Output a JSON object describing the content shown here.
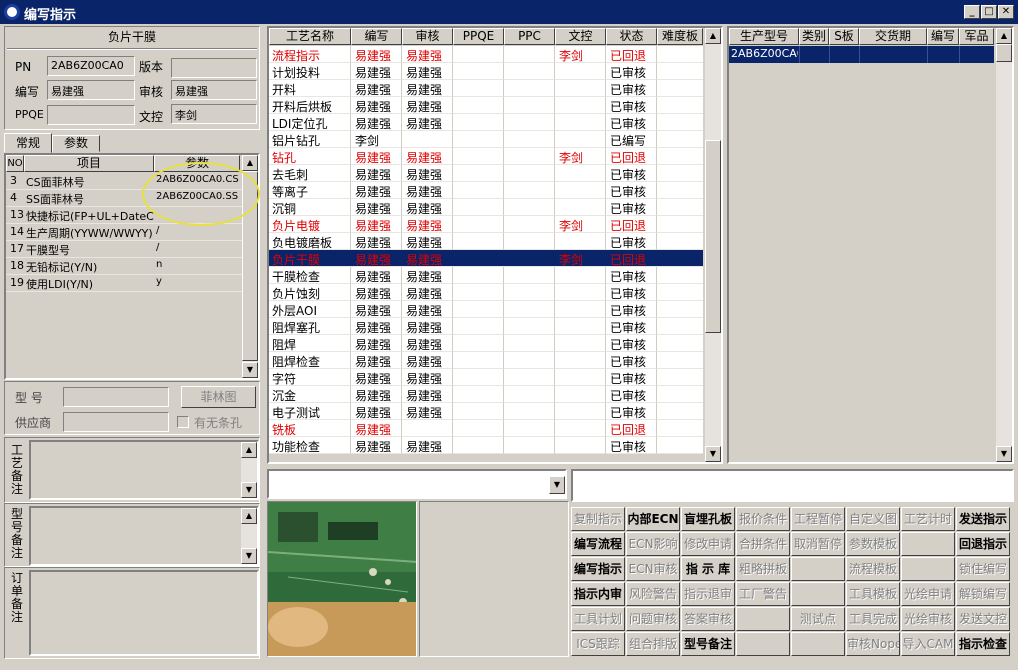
{
  "window": {
    "title": "编写指示"
  },
  "left": {
    "header": "负片干膜",
    "fields": {
      "pn_label": "PN",
      "pn_value": "2AB6Z00CA0",
      "version_label": "版本",
      "version_value": "",
      "author_label": "编写",
      "author_value": "易建强",
      "review_label": "审核",
      "review_value": "易建强",
      "ppqe_label": "PPQE",
      "ppqe_value": "",
      "doc_label": "文控",
      "doc_value": "李剑"
    },
    "tabs": [
      "常规",
      "参数"
    ],
    "param_table": {
      "headers": [
        "NO",
        "项目",
        "参数"
      ],
      "rows": [
        {
          "no": "3",
          "item": "CS面菲林号",
          "value": "2AB6Z00CA0.CS"
        },
        {
          "no": "4",
          "item": "SS面菲林号",
          "value": "2AB6Z00CA0.SS"
        },
        {
          "no": "13",
          "item": "快捷标记(FP+UL+DateC)",
          "value": ""
        },
        {
          "no": "14",
          "item": "生产周期(YYWW/WWYY)",
          "value": "/"
        },
        {
          "no": "17",
          "item": "干膜型号",
          "value": "/"
        },
        {
          "no": "18",
          "item": "无铅标记(Y/N)",
          "value": "n"
        },
        {
          "no": "19",
          "item": "使用LDI(Y/N)",
          "value": "y"
        }
      ]
    },
    "model_label": "型 号",
    "supplier_label": "供应商",
    "film_button": "菲林图",
    "slot_checkbox": "有无条孔",
    "remarks": [
      {
        "label": "工艺备注"
      },
      {
        "label": "型号备注"
      },
      {
        "label": "订单备注"
      }
    ]
  },
  "process_table": {
    "headers": [
      "工艺名称",
      "编写",
      "审核",
      "PPQE",
      "PPC",
      "文控",
      "状态",
      "难度板"
    ],
    "rows": [
      {
        "name": "流程指示",
        "author": "易建强",
        "review": "易建强",
        "ppqe": "",
        "ppc": "",
        "doc": "李剑",
        "status": "已回退",
        "red": true
      },
      {
        "name": "计划投料",
        "author": "易建强",
        "review": "易建强",
        "ppqe": "",
        "ppc": "",
        "doc": "",
        "status": "已审核",
        "red": false
      },
      {
        "name": "开料",
        "author": "易建强",
        "review": "易建强",
        "ppqe": "",
        "ppc": "",
        "doc": "",
        "status": "已审核",
        "red": false
      },
      {
        "name": "开料后烘板",
        "author": "易建强",
        "review": "易建强",
        "ppqe": "",
        "ppc": "",
        "doc": "",
        "status": "已审核",
        "red": false
      },
      {
        "name": "LDI定位孔",
        "author": "易建强",
        "review": "易建强",
        "ppqe": "",
        "ppc": "",
        "doc": "",
        "status": "已审核",
        "red": false
      },
      {
        "name": "铝片钻孔",
        "author": "李剑",
        "review": "",
        "ppqe": "",
        "ppc": "",
        "doc": "",
        "status": "已编写",
        "red": false
      },
      {
        "name": "钻孔",
        "author": "易建强",
        "review": "易建强",
        "ppqe": "",
        "ppc": "",
        "doc": "李剑",
        "status": "已回退",
        "red": true
      },
      {
        "name": "去毛刺",
        "author": "易建强",
        "review": "易建强",
        "ppqe": "",
        "ppc": "",
        "doc": "",
        "status": "已审核",
        "red": false
      },
      {
        "name": "等离子",
        "author": "易建强",
        "review": "易建强",
        "ppqe": "",
        "ppc": "",
        "doc": "",
        "status": "已审核",
        "red": false
      },
      {
        "name": "沉铜",
        "author": "易建强",
        "review": "易建强",
        "ppqe": "",
        "ppc": "",
        "doc": "",
        "status": "已审核",
        "red": false
      },
      {
        "name": "负片电镀",
        "author": "易建强",
        "review": "易建强",
        "ppqe": "",
        "ppc": "",
        "doc": "李剑",
        "status": "已回退",
        "red": true
      },
      {
        "name": "负电镀磨板",
        "author": "易建强",
        "review": "易建强",
        "ppqe": "",
        "ppc": "",
        "doc": "",
        "status": "已审核",
        "red": false
      },
      {
        "name": "负片干膜",
        "author": "易建强",
        "review": "易建强",
        "ppqe": "",
        "ppc": "",
        "doc": "李剑",
        "status": "已回退",
        "red": true,
        "selected": true
      },
      {
        "name": "干膜检查",
        "author": "易建强",
        "review": "易建强",
        "ppqe": "",
        "ppc": "",
        "doc": "",
        "status": "已审核",
        "red": false
      },
      {
        "name": "负片蚀刻",
        "author": "易建强",
        "review": "易建强",
        "ppqe": "",
        "ppc": "",
        "doc": "",
        "status": "已审核",
        "red": false
      },
      {
        "name": "外层AOI",
        "author": "易建强",
        "review": "易建强",
        "ppqe": "",
        "ppc": "",
        "doc": "",
        "status": "已审核",
        "red": false
      },
      {
        "name": "阻焊塞孔",
        "author": "易建强",
        "review": "易建强",
        "ppqe": "",
        "ppc": "",
        "doc": "",
        "status": "已审核",
        "red": false
      },
      {
        "name": "阻焊",
        "author": "易建强",
        "review": "易建强",
        "ppqe": "",
        "ppc": "",
        "doc": "",
        "status": "已审核",
        "red": false
      },
      {
        "name": "阻焊检查",
        "author": "易建强",
        "review": "易建强",
        "ppqe": "",
        "ppc": "",
        "doc": "",
        "status": "已审核",
        "red": false
      },
      {
        "name": "字符",
        "author": "易建强",
        "review": "易建强",
        "ppqe": "",
        "ppc": "",
        "doc": "",
        "status": "已审核",
        "red": false
      },
      {
        "name": "沉金",
        "author": "易建强",
        "review": "易建强",
        "ppqe": "",
        "ppc": "",
        "doc": "",
        "status": "已审核",
        "red": false
      },
      {
        "name": "电子测试",
        "author": "易建强",
        "review": "易建强",
        "ppqe": "",
        "ppc": "",
        "doc": "",
        "status": "已审核",
        "red": false
      },
      {
        "name": "铣板",
        "author": "易建强",
        "review": "",
        "ppqe": "",
        "ppc": "",
        "doc": "",
        "status": "已回退",
        "red": true
      },
      {
        "name": "功能检查",
        "author": "易建强",
        "review": "易建强",
        "ppqe": "",
        "ppc": "",
        "doc": "",
        "status": "已审核",
        "red": false
      }
    ]
  },
  "product_table": {
    "headers": [
      "生产型号",
      "类别",
      "S板",
      "交货期",
      "编写",
      "军品"
    ],
    "rows": [
      {
        "model": "2AB6Z00CA0",
        "type": "",
        "s": "",
        "due": "",
        "author": "",
        "mil": ""
      }
    ]
  },
  "buttons": [
    [
      "复制指示",
      "内部ECN",
      "盲埋孔板",
      "报价条件",
      "工程暂停",
      "自定义图",
      "工艺计时",
      "发送指示"
    ],
    [
      "编写流程",
      "ECN影响",
      "修改申请",
      "合拼条件",
      "取消暂停",
      "参数模板",
      "",
      "回退指示"
    ],
    [
      "编写指示",
      "ECN审核",
      "指 示 库",
      "粗略拼板",
      "",
      "流程模板",
      "",
      "锁住编写"
    ],
    [
      "指示内审",
      "风险警告",
      "指示退审",
      "工厂警告",
      "",
      "工具模板",
      "光绘申请",
      "解锁编写"
    ],
    [
      "工具计划",
      "问题审核",
      "答案审核",
      "",
      "测试点",
      "工具完成",
      "光绘审核",
      "发送文控"
    ],
    [
      "ICS跟踪",
      "组合排版",
      "型号备注",
      "",
      "",
      "审核Nope",
      "导入CAM",
      "指示检查"
    ]
  ],
  "buttons_disabled": [
    [
      true,
      false,
      false,
      true,
      true,
      true,
      true,
      false
    ],
    [
      false,
      true,
      true,
      true,
      true,
      true,
      true,
      false
    ],
    [
      false,
      true,
      false,
      true,
      true,
      true,
      true,
      true
    ],
    [
      false,
      true,
      true,
      true,
      true,
      true,
      true,
      true
    ],
    [
      true,
      true,
      true,
      true,
      true,
      true,
      true,
      true
    ],
    [
      true,
      true,
      false,
      true,
      true,
      true,
      true,
      false
    ]
  ]
}
